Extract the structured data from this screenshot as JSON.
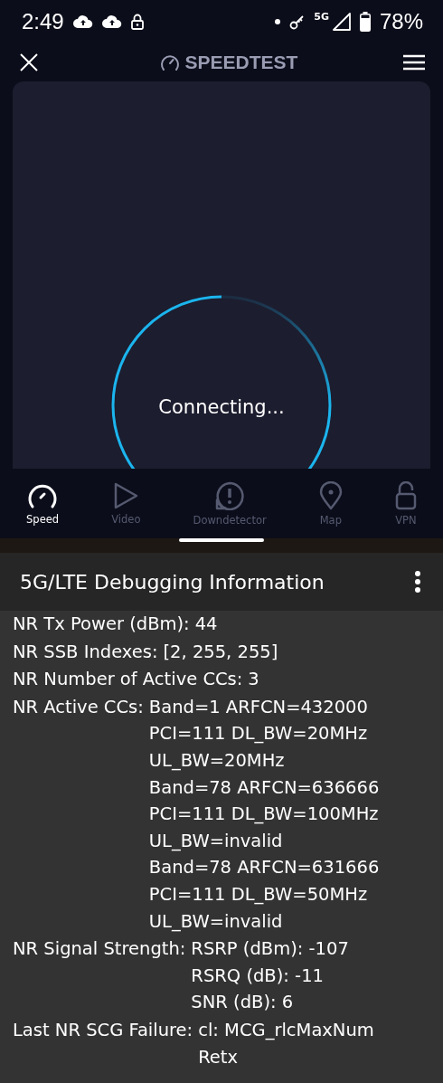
{
  "status_bar": {
    "time": "2:49",
    "network": "5G",
    "battery": "78%"
  },
  "app_header": {
    "title": "SPEEDTEST"
  },
  "test": {
    "status": "Connecting..."
  },
  "nav": [
    {
      "label": "Speed",
      "kind": "speed",
      "selected": true
    },
    {
      "label": "Video",
      "kind": "video",
      "selected": false
    },
    {
      "label": "Downdetector",
      "kind": "downdetector",
      "selected": false
    },
    {
      "label": "Map",
      "kind": "map",
      "selected": false
    },
    {
      "label": "VPN",
      "kind": "vpn",
      "selected": false
    }
  ],
  "debug_panel": {
    "title": "5G/LTE Debugging Information",
    "rows": [
      {
        "label": "NR Tx Power (dBm):",
        "values": [
          "44"
        ]
      },
      {
        "label": "NR SSB Indexes:",
        "values": [
          "[2, 255, 255]"
        ]
      },
      {
        "label": "NR Number of Active CCs:",
        "values": [
          "3"
        ]
      },
      {
        "label": "NR Active CCs:",
        "values": [
          "Band=1 ARFCN=432000",
          "PCI=111 DL_BW=20MHz",
          "UL_BW=20MHz",
          "Band=78 ARFCN=636666",
          "PCI=111 DL_BW=100MHz",
          "UL_BW=invalid",
          "Band=78 ARFCN=631666",
          "PCI=111 DL_BW=50MHz",
          "UL_BW=invalid"
        ]
      },
      {
        "label": "NR Signal Strength:",
        "values": [
          "RSRP (dBm): -107",
          "RSRQ (dB): -11",
          "SNR (dB): 6"
        ]
      },
      {
        "label": "Last NR SCG Failure:",
        "values": [
          "cl: MCG_rlcMaxNum",
          "Retx"
        ]
      }
    ]
  }
}
